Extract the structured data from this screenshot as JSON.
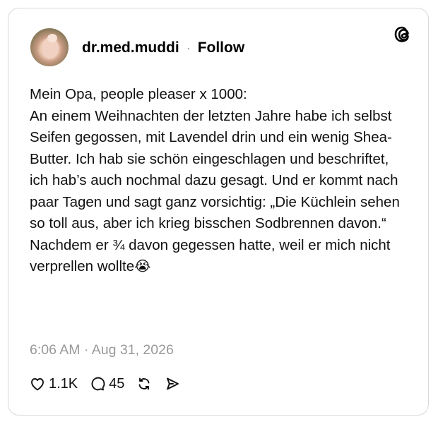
{
  "post": {
    "username": "dr.med.muddi",
    "separator": "·",
    "follow_label": "Follow",
    "body": "Mein Opa, people pleaser x 1000:\nAn einem Weihnachten der letzten Jahre habe ich selbst Seifen gegossen, mit Lavendel drin und ein wenig Shea-Butter. Ich hab sie schön eingeschlagen und beschriftet, ich hab’s auch nochmal dazu gesagt. Und er kommt nach paar Tagen und sagt ganz vorsichtig: „Die Küchlein sehen so toll aus, aber ich krieg bisschen Sodbrennen davon.“\nNachdem er ¾ davon gegessen hatte, weil er mich nicht verprellen wollte",
    "emoji": "😭",
    "timestamp": "6:06 AM · Aug 31, 2026"
  },
  "actions": {
    "likes": "1.1K",
    "replies": "45"
  },
  "icons": {
    "logo": "threads-logo-icon",
    "like": "heart-icon",
    "reply": "comment-icon",
    "repost": "repost-icon",
    "share": "share-icon"
  }
}
